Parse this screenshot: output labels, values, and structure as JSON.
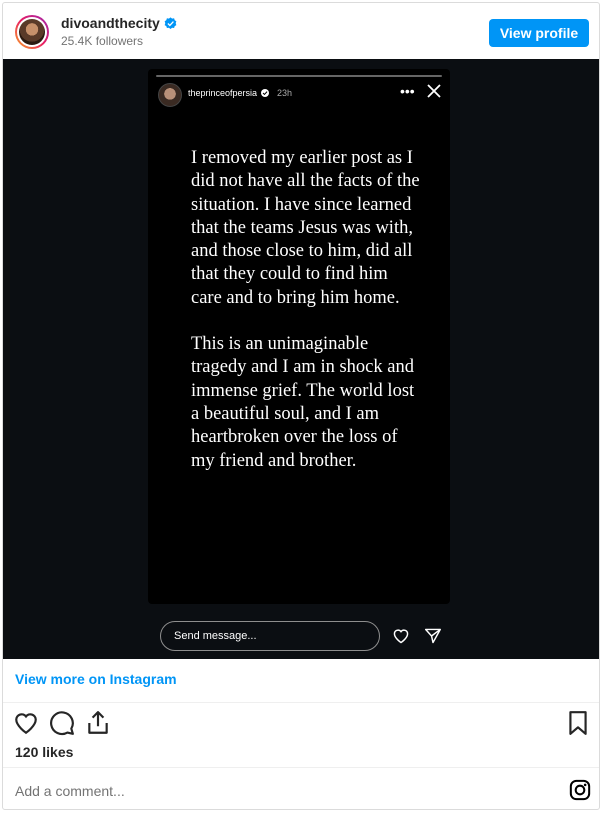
{
  "header": {
    "username": "divoandthecity",
    "followers": "25.4K followers",
    "view_profile_label": "View profile"
  },
  "story": {
    "username": "theprinceofpersia",
    "time": "23h",
    "dots": "•••",
    "paragraphs": [
      "I removed my earlier post as I did not have all the facts of the situation. I have since learned that the teams Jesus was with, and those close to him, did all that they could to find him care and to bring him home.",
      "This is an unimaginable tragedy and I am in shock and immense grief. The world lost a beautiful soul, and I am heartbroken over the loss of my friend and brother."
    ],
    "send_placeholder": "Send message..."
  },
  "footer": {
    "view_more_label": "View more on Instagram",
    "likes": "120 likes",
    "comment_placeholder": "Add a comment..."
  },
  "colors": {
    "accent": "#0095f6",
    "verified": "#0095f6",
    "media_bg": "#0b0e12"
  }
}
